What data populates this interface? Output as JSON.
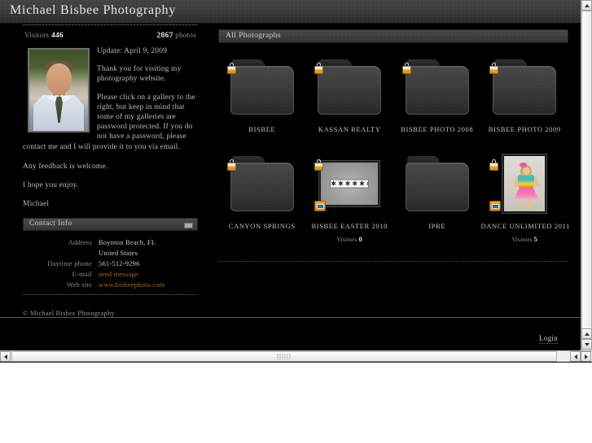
{
  "header": {
    "site_title": "Michael Bisbee Photography"
  },
  "sidebar": {
    "visitors_label": "Visitors",
    "visitors_count": "446",
    "photos_count": "2867",
    "photos_label": "photos",
    "portrait_alt": "portrait-photo",
    "bio": {
      "update": "Update: April 9, 2009",
      "p1": "Thank you for visiting my photography website.",
      "p2": "Please click on a gallery to the right, but keep in mind that some of my galleries are password protected. If you do not have a password, please contact me and I will provide it to you via email.",
      "p3": "Any feedback is welcome.",
      "p4": "I hope you enjoy.",
      "p5": "Michael"
    },
    "contact": {
      "panel_title": "Contact Info",
      "rows": [
        {
          "key": "Address",
          "value": "Boynton Beach, FL"
        },
        {
          "key": "",
          "value": "United States"
        },
        {
          "key": "Daytime phone",
          "value": "561-512-9296"
        },
        {
          "key": "E-mail",
          "value": "send message",
          "link": true
        },
        {
          "key": "Web site",
          "value": "www.bisbeephoto.com",
          "link": true
        }
      ]
    },
    "copyright": "© Michael Bisbee Photography"
  },
  "gallery": {
    "panel_title": "All Photographs",
    "rows": [
      [
        {
          "label": "BISBEE",
          "type": "folder",
          "locked": true,
          "cart": false,
          "visitors": null
        },
        {
          "label": "KASSAN REALTY",
          "type": "folder",
          "locked": true,
          "cart": false,
          "visitors": null
        },
        {
          "label": "BISBEE PHOTO 2008",
          "type": "folder",
          "locked": true,
          "cart": false,
          "visitors": null
        },
        {
          "label": "BISBEE PHOTO 2009",
          "type": "folder",
          "locked": true,
          "cart": false,
          "visitors": null
        }
      ],
      [
        {
          "label": "CANYON SPRINGS",
          "type": "folder",
          "locked": true,
          "cart": false,
          "visitors": null
        },
        {
          "label": "BISBEE EASTER 2010",
          "type": "password",
          "locked": true,
          "cart": true,
          "visitors_label": "Visitors",
          "visitors": "0",
          "password_mask": "✱✱✱✱✱✱"
        },
        {
          "label": "IPRE",
          "type": "folder",
          "locked": false,
          "cart": false,
          "visitors": null
        },
        {
          "label": "DANCE UNLIMITED 2011",
          "type": "photo",
          "locked": true,
          "cart": true,
          "visitors_label": "Visitors",
          "visitors": "5"
        }
      ]
    ]
  },
  "footer": {
    "login_label": "Login"
  },
  "colors": {
    "page_background": "#000000",
    "panel_header": "#3e3e3e",
    "link_orange": "#a86a22",
    "text_primary": "#c2c2c2",
    "lock_badge": "#e9a126"
  }
}
